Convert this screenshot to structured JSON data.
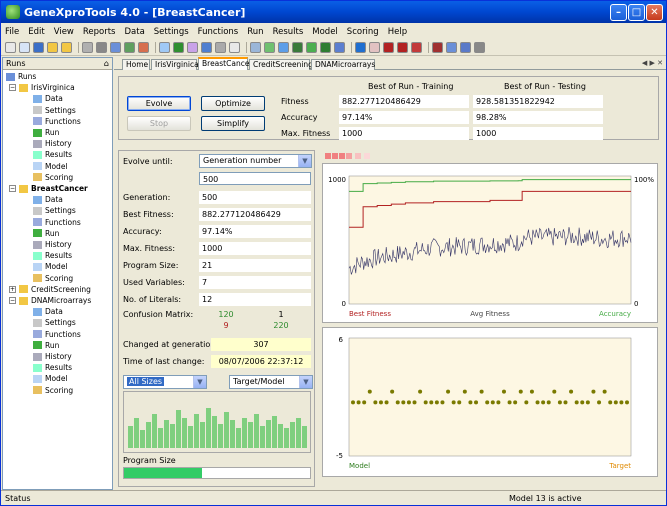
{
  "window": {
    "title": "GeneXproTools 4.0 - [BreastCancer]"
  },
  "menu": [
    "File",
    "Edit",
    "View",
    "Reports",
    "Data",
    "Settings",
    "Functions",
    "Run",
    "Results",
    "Model",
    "Scoring",
    "Help"
  ],
  "runs_panel": {
    "title": "Runs",
    "pin": "⌂",
    "root": "Runs",
    "groups": [
      {
        "name": "IrisVirginica",
        "items": [
          "Data",
          "Settings",
          "Functions",
          "Run",
          "History",
          "Results",
          "Model",
          "Scoring"
        ]
      },
      {
        "name": "BreastCancer",
        "items": [
          "Data",
          "Settings",
          "Functions",
          "Run",
          "History",
          "Results",
          "Model",
          "Scoring"
        ]
      },
      {
        "name": "CreditScreening",
        "items": []
      },
      {
        "name": "DNAMicroarrays",
        "items": [
          "Data",
          "Settings",
          "Functions",
          "Run",
          "History",
          "Results",
          "Model",
          "Scoring"
        ]
      }
    ]
  },
  "tabs": [
    "Home",
    "IrisVirginica",
    "BreastCancer",
    "CreditScreening",
    "DNAMicroarrays"
  ],
  "tab_nav": "◀ ▶ ✕",
  "controls": {
    "evolve": "Evolve",
    "optimize": "Optimize",
    "stop": "Stop",
    "simplify": "Simplify"
  },
  "best_of_run": {
    "training_header": "Best of Run - Training",
    "testing_header": "Best of Run - Testing",
    "rows": [
      {
        "label": "Fitness",
        "training": "882.277120486429",
        "testing": "928.581351822942"
      },
      {
        "label": "Accuracy",
        "training": "97.14%",
        "testing": "98.28%"
      },
      {
        "label": "Max. Fitness",
        "training": "1000",
        "testing": "1000"
      }
    ]
  },
  "run_stats": {
    "evolve_until_label": "Evolve until:",
    "evolve_until_value": "Generation number",
    "generations_target": "500",
    "rows": [
      {
        "label": "Generation:",
        "value": "500"
      },
      {
        "label": "Best Fitness:",
        "value": "882.277120486429"
      },
      {
        "label": "Accuracy:",
        "value": "97.14%"
      },
      {
        "label": "Max. Fitness:",
        "value": "1000"
      },
      {
        "label": "Program Size:",
        "value": "21"
      },
      {
        "label": "Used Variables:",
        "value": "7"
      },
      {
        "label": "No. of Literals:",
        "value": "12"
      }
    ],
    "confusion_label": "Confusion Matrix:",
    "confusion": {
      "tp": "120",
      "fp": "1",
      "fn": "9",
      "tn": "220"
    },
    "changed_label": "Changed at generation:",
    "changed_value": "307",
    "time_label": "Time of last change:",
    "time_value": "08/07/2006 22:37:12",
    "size_filter": "All Sizes",
    "target_filter": "Target/Model",
    "program_size_label": "Program Size",
    "program_size_progress": 0.42
  },
  "fitness_chart": {
    "y_left_max": "1000",
    "y_left_min": "0",
    "y_right_max": "100%",
    "y_right_min": "0",
    "legend_best": "Best Fitness",
    "legend_avg": "Avg Fitness",
    "legend_acc": "Accuracy",
    "color_best": "#b22222",
    "color_avg": "#333366",
    "color_acc": "#44aa44"
  },
  "model_chart": {
    "y_max": "6",
    "y_min": "-5",
    "legend_model": "Model",
    "legend_target": "Target",
    "color_model": "#2e7d1e",
    "color_target": "#e08a00",
    "color_points": "#7a7a00"
  },
  "status": {
    "left": "Status",
    "right": "Model 13 is active"
  },
  "chart_data": [
    {
      "type": "line",
      "title": "",
      "xlabel": "",
      "ylabel": "",
      "ylim": [
        0,
        1000
      ],
      "x": [
        0,
        25,
        50,
        75,
        100,
        150,
        200,
        250,
        300,
        307,
        350,
        400,
        450,
        500
      ],
      "series": [
        {
          "name": "Best Fitness",
          "values": [
            600,
            760,
            770,
            780,
            790,
            800,
            800,
            810,
            810,
            880,
            880,
            880,
            880,
            880
          ]
        },
        {
          "name": "Avg Fitness",
          "values": [
            280,
            330,
            360,
            380,
            400,
            440,
            450,
            470,
            480,
            520,
            520,
            530,
            510,
            520
          ]
        },
        {
          "name": "Accuracy",
          "values": [
            88,
            94,
            94.5,
            95,
            95.5,
            96,
            96,
            96.2,
            96.3,
            97.14,
            97.14,
            97.14,
            97.14,
            97.14
          ]
        }
      ],
      "right_axis": {
        "ylim": [
          0,
          100
        ],
        "unit": "%"
      },
      "grid": false,
      "legend": "bottom"
    },
    {
      "type": "scatter",
      "title": "",
      "ylim": [
        -5,
        6
      ],
      "series": [
        {
          "name": "Model",
          "values": [
            0,
            0,
            0,
            1,
            0,
            0,
            0,
            1,
            0,
            0,
            0,
            0,
            1,
            0,
            0,
            0,
            0,
            1,
            0,
            0,
            1,
            0,
            0,
            1,
            0,
            0,
            0,
            1,
            0,
            0,
            1,
            0,
            1,
            0,
            0,
            0,
            1,
            0,
            0,
            1,
            0,
            0,
            0,
            1,
            0,
            1,
            0,
            0,
            0,
            0
          ]
        },
        {
          "name": "Target",
          "values": [
            0,
            0,
            0,
            1,
            0,
            0,
            0,
            1,
            0,
            0,
            0,
            0,
            1,
            0,
            0,
            0,
            0,
            1,
            0,
            0,
            1,
            0,
            0,
            1,
            0,
            0,
            0,
            1,
            0,
            0,
            1,
            0,
            1,
            0,
            0,
            0,
            1,
            0,
            0,
            1,
            0,
            0,
            0,
            1,
            0,
            1,
            0,
            0,
            0,
            0
          ]
        }
      ],
      "legend": "bottom"
    }
  ]
}
